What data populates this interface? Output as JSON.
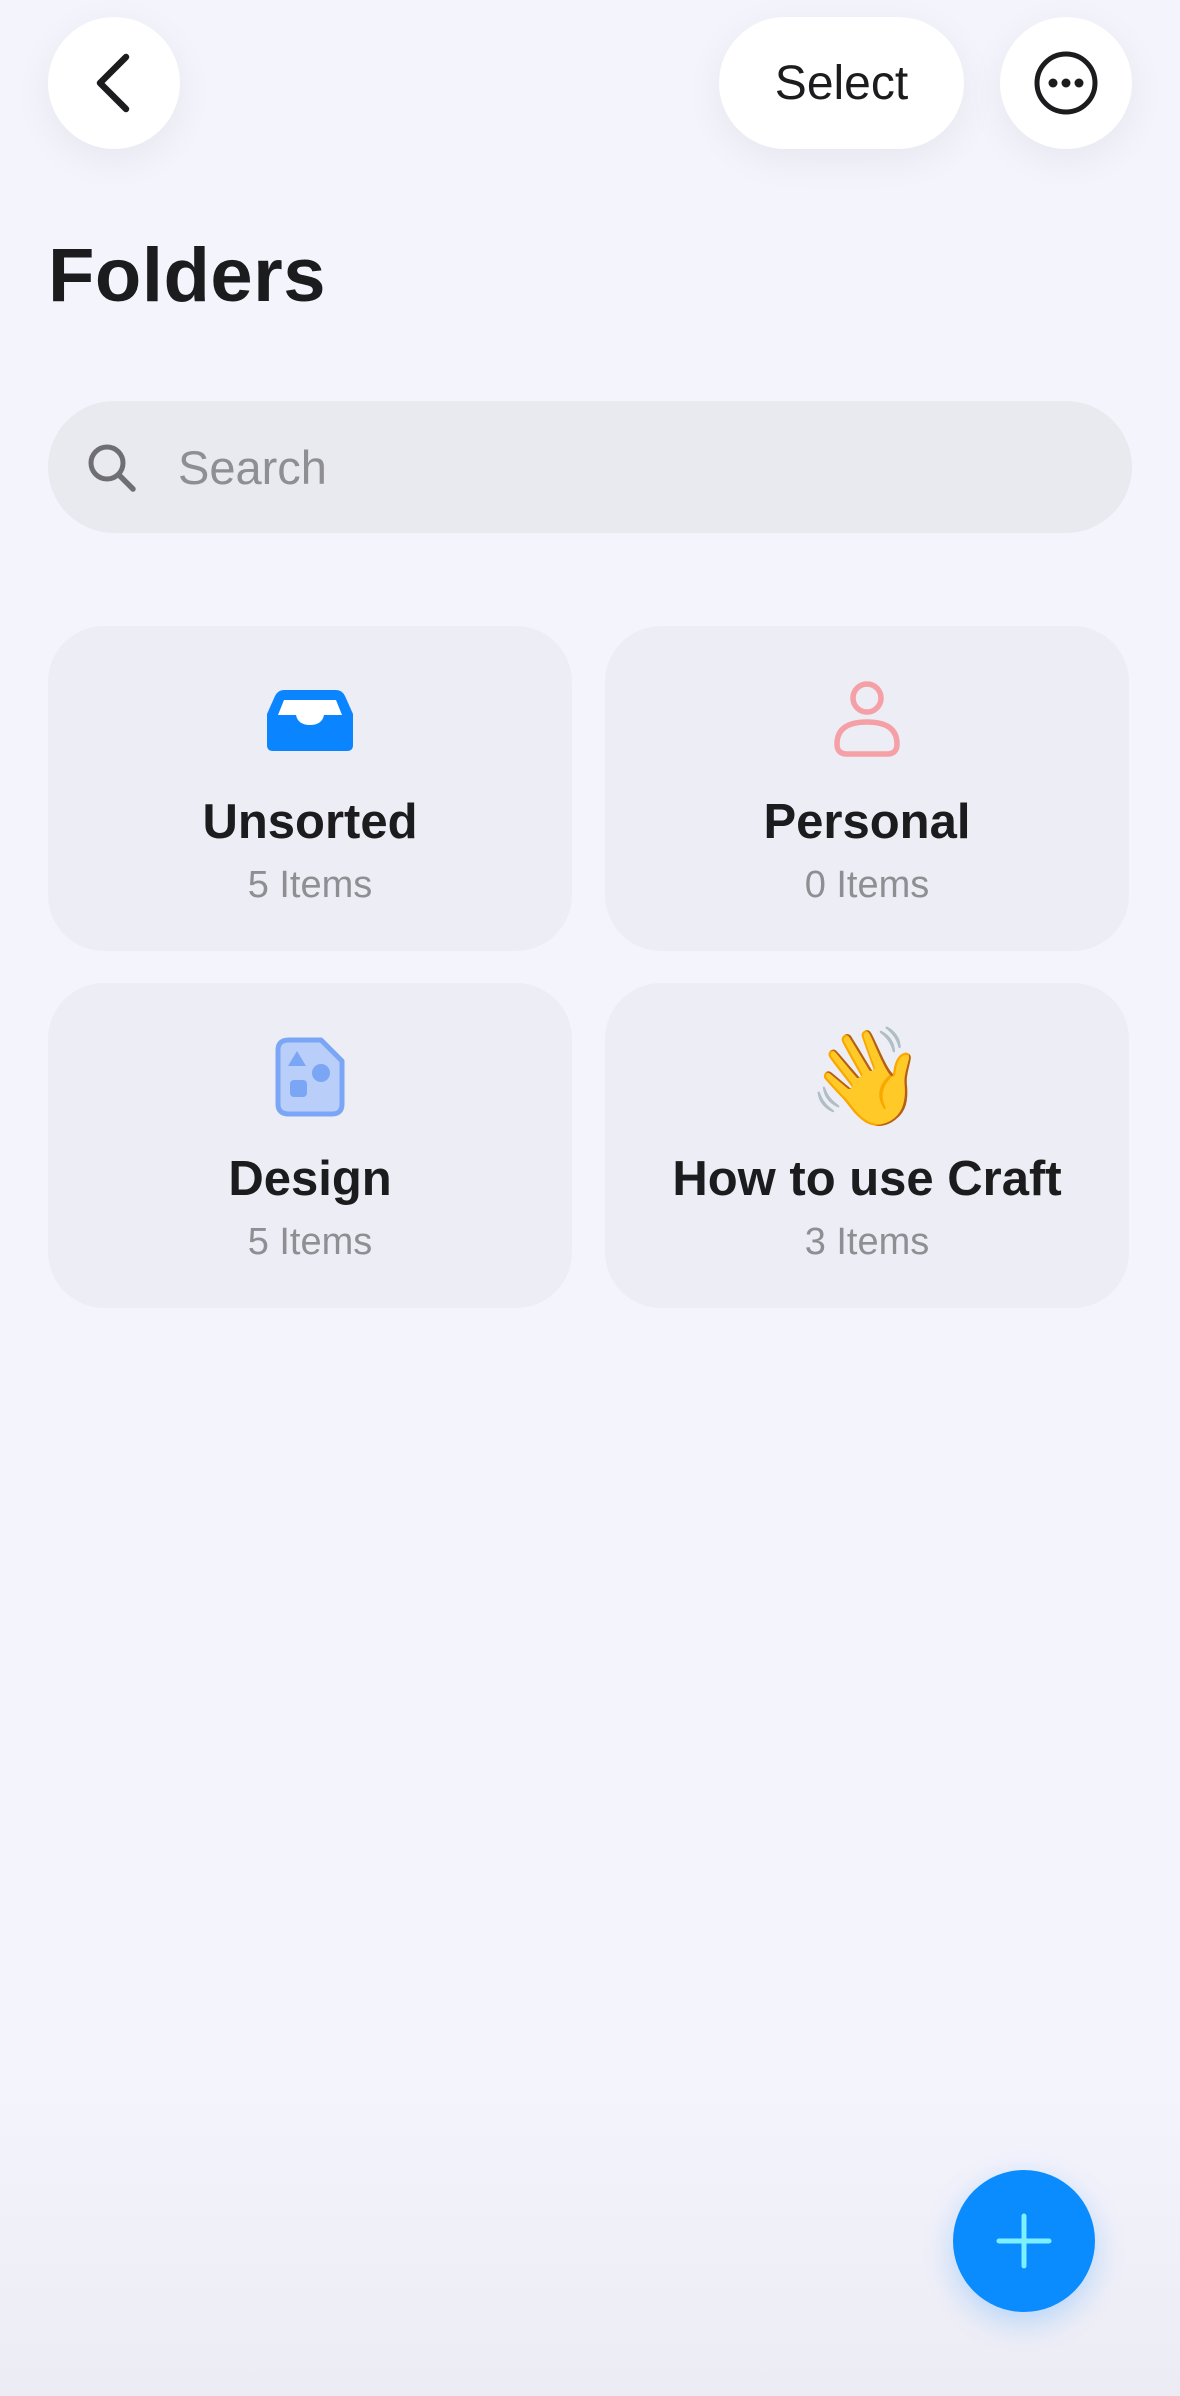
{
  "header": {
    "title": "Folders",
    "select_label": "Select"
  },
  "search": {
    "placeholder": "Search",
    "value": ""
  },
  "folders": [
    {
      "name": "Unsorted",
      "count": "5 Items",
      "icon": "inbox-tray-icon",
      "color": "#0a84ff"
    },
    {
      "name": "Personal",
      "count": "0 Items",
      "icon": "person-icon",
      "color": "#f4a0a6"
    },
    {
      "name": "Design",
      "count": "5 Items",
      "icon": "shapes-document-icon",
      "color": "#7aa6f5"
    },
    {
      "name": "How to use Craft",
      "count": "3 Items",
      "icon": "waving-hand-emoji",
      "emoji": "👋"
    }
  ],
  "fab": {
    "icon": "plus-icon",
    "color": "#0a8cff"
  }
}
